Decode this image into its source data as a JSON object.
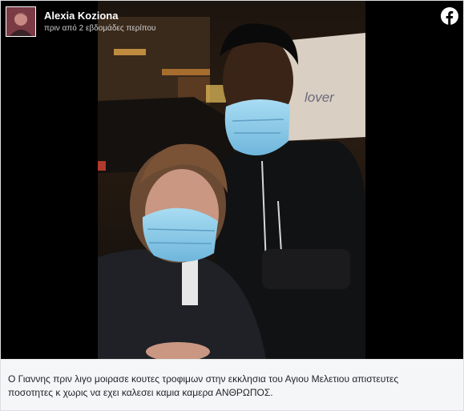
{
  "post": {
    "author": "Alexia Koziona",
    "timestamp": "πριν από 2 εβδομάδες περίπου",
    "caption": "Ο Γιαννης πριν λιγο μοιρασε κουτες τροφιμων στην εκκλησια του Αγιου Μελετιου απιστευτες ποσοτητες κ χωρις να εχει καλεσει καμια καμερα ΑΝΘΡΩΠΟΣ."
  },
  "photo": {
    "sign_text": "lover"
  },
  "icons": {
    "brand": "facebook-icon"
  },
  "colors": {
    "facebook": "#ffffff",
    "caption_bg": "#f5f6f7",
    "text": "#1d2129",
    "mask": "#8cc8e8"
  }
}
